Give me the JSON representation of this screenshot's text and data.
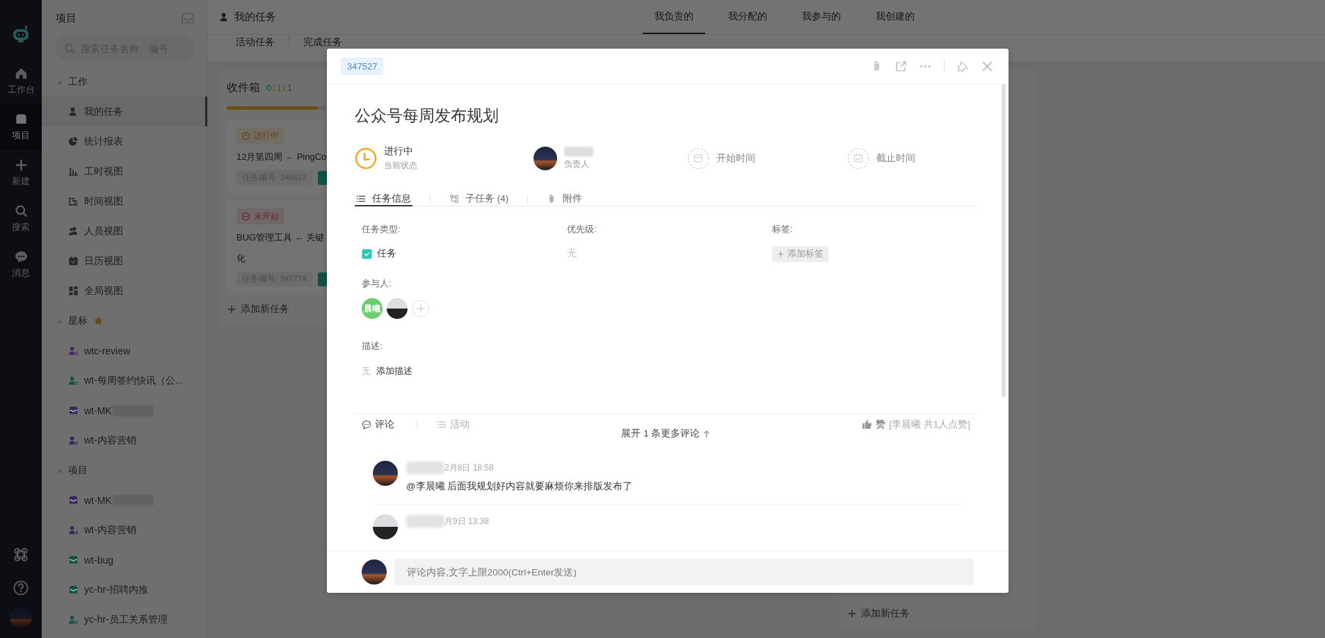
{
  "nav_rail": {
    "items": [
      {
        "kind": "home",
        "label": "工作台",
        "selected": false
      },
      {
        "kind": "inbox",
        "label": "项目",
        "selected": true
      },
      {
        "kind": "plus",
        "label": "新建",
        "selected": false
      },
      {
        "kind": "search",
        "label": "搜索",
        "selected": false
      },
      {
        "kind": "chat",
        "label": "消息",
        "selected": false
      }
    ],
    "bottom": [
      {
        "kind": "command"
      },
      {
        "kind": "help"
      },
      {
        "kind": "avatar"
      }
    ]
  },
  "project_panel": {
    "title": "项目",
    "search": {
      "placeholder": "搜索任务名称、编号"
    },
    "groups": [
      {
        "label": "工作",
        "expanded": true,
        "starred": false,
        "children": [
          {
            "label": "我的任务",
            "kind": "person",
            "redacted": false,
            "selected": true
          },
          {
            "label": "统计报表",
            "kind": "pie",
            "redacted": false,
            "selected": false
          },
          {
            "label": "工时视图",
            "kind": "bars",
            "redacted": false,
            "selected": false
          },
          {
            "label": "时间视图",
            "kind": "gantt",
            "redacted": false,
            "selected": false
          },
          {
            "label": "人员视图",
            "kind": "people",
            "redacted": false,
            "selected": false
          },
          {
            "label": "日历视图",
            "kind": "calendar",
            "redacted": false,
            "selected": false
          },
          {
            "label": "全局视图",
            "kind": "grid",
            "redacted": false,
            "selected": false
          }
        ]
      },
      {
        "label": "星标",
        "expanded": true,
        "starred": true,
        "children": [
          {
            "label": "wtc-review",
            "kind": "person-list",
            "color": "#46285e",
            "redacted": false,
            "selected": false
          },
          {
            "label": "wt-每周签约快讯（公...",
            "kind": "person-list",
            "color": "#0e5345",
            "redacted": false,
            "selected": false
          },
          {
            "label": "wt-MK",
            "kind": "inbox",
            "color": "#372960",
            "redacted": true,
            "selected": false
          },
          {
            "label": "wt-内容营销",
            "kind": "person-list",
            "color": "#302960",
            "redacted": false,
            "selected": false
          }
        ]
      },
      {
        "label": "项目",
        "expanded": true,
        "starred": false,
        "children": [
          {
            "label": "wt-MK",
            "kind": "inbox",
            "color": "#372960",
            "redacted": true,
            "selected": false
          },
          {
            "label": "wt-内容营销",
            "kind": "person-list",
            "color": "#302960",
            "redacted": false,
            "selected": false
          },
          {
            "label": "wt-bug",
            "kind": "inbox",
            "color": "#0e5345",
            "redacted": false,
            "selected": false
          },
          {
            "label": "yc-hr-招聘内推",
            "kind": "inbox",
            "color": "#0e5345",
            "redacted": false,
            "selected": false
          },
          {
            "label": "yc-hr-员工关系管理",
            "kind": "person-list",
            "color": "#0e5345",
            "redacted": false,
            "selected": false
          }
        ]
      }
    ]
  },
  "header": {
    "title": "我的任务",
    "tabs": [
      {
        "label": "我负责的",
        "selected": true
      },
      {
        "label": "我分配的",
        "selected": false
      },
      {
        "label": "我参与的",
        "selected": false
      },
      {
        "label": "我创建的",
        "selected": false
      }
    ]
  },
  "sub_tabs": [
    {
      "label": "活动任务"
    },
    {
      "label": "完成任务"
    }
  ],
  "board": {
    "columns": [
      {
        "title": "收件箱",
        "counts": [
          {
            "text": "0",
            "color": "#0e5345"
          },
          {
            "text": "1",
            "color": "#6c480e"
          },
          {
            "text": "1",
            "color": "#454545"
          }
        ],
        "count_separator": "/",
        "level": 0.87,
        "cards": [
          {
            "kind": "in_progress",
            "status": "进行中",
            "title_lines": [
              "12月第四周 ← PingCo"
            ],
            "number": "任务编号: 348527"
          },
          {
            "kind": "not_started",
            "status": "未开始",
            "title_lines": [
              "BUG管理工具 ← 关键",
              "化"
            ],
            "number": "任务编号: 347774"
          }
        ],
        "add_label": "添加新任务"
      },
      {
        "add_label": "添加新任务"
      }
    ]
  },
  "modal": {
    "task_id": "347527",
    "title": "公众号每周发布规划",
    "status": {
      "value": "进行中",
      "label": "当前状态"
    },
    "assignee": {
      "label": "负责人"
    },
    "start": {
      "label": "开始时间"
    },
    "due": {
      "label": "截止时间"
    },
    "tabs": [
      {
        "label": "任务信息",
        "kind": "list",
        "selected": true
      },
      {
        "label": "子任务 (4)",
        "kind": "subtasks",
        "selected": false
      },
      {
        "label": "附件",
        "kind": "attachment",
        "selected": false
      }
    ],
    "fields": [
      {
        "label": "任务类型:",
        "kind": "type",
        "value": "任务"
      },
      {
        "label": "优先级:",
        "kind": "empty",
        "value": "无"
      },
      {
        "label": "标签:",
        "kind": "tag_button",
        "value": "添加标签"
      }
    ],
    "participants": {
      "label": "参与人:",
      "members": [
        {
          "kind": "initials",
          "text": "晨曦"
        },
        {
          "kind": "photo"
        }
      ]
    },
    "description": {
      "label": "描述:",
      "empty_text": "无",
      "action": "添加描述"
    },
    "activity_tabs": [
      {
        "label": "评论",
        "kind": "comment",
        "selected": true
      },
      {
        "label": "活动",
        "kind": "list",
        "selected": false
      }
    ],
    "likes": {
      "label": "赞",
      "detail": "[李晨曦 共1人点赞]"
    },
    "expand_more": "展开 1 条更多评论",
    "comments": [
      {
        "time": "2月8日 18:58",
        "text": "@李晨曦 后面我规划好内容就要麻烦你来排版发布了"
      },
      {
        "time": "月9日 13:38"
      }
    ],
    "comment_input": {
      "placeholder": "评论内容,文字上限2000(Ctrl+Enter发送)"
    }
  }
}
